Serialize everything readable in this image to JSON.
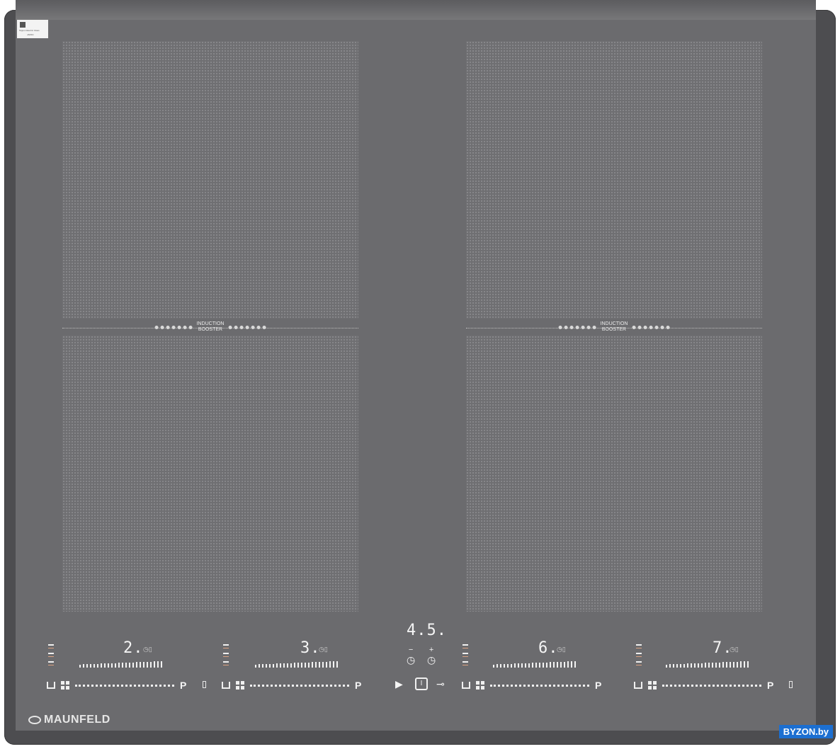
{
  "brand": "MAUNFELD",
  "badge": {
    "line1": "Nippon Electric Glass",
    "line2": "JAPAN"
  },
  "booster_label": [
    "INDUCTION",
    "BOOSTER"
  ],
  "timer_display": "4.5.",
  "zones": [
    {
      "display": "2."
    },
    {
      "display": "3."
    },
    {
      "display": "6."
    },
    {
      "display": "7."
    }
  ],
  "power_key": "P",
  "timer_controls": {
    "minus": "−",
    "plus": "+"
  },
  "watermark": "BYZON.by",
  "colors": {
    "glass": "#6b6b6e",
    "frame": "#4d4d50",
    "display": "#f5f5f5",
    "watermark": "#1c6fd1"
  }
}
